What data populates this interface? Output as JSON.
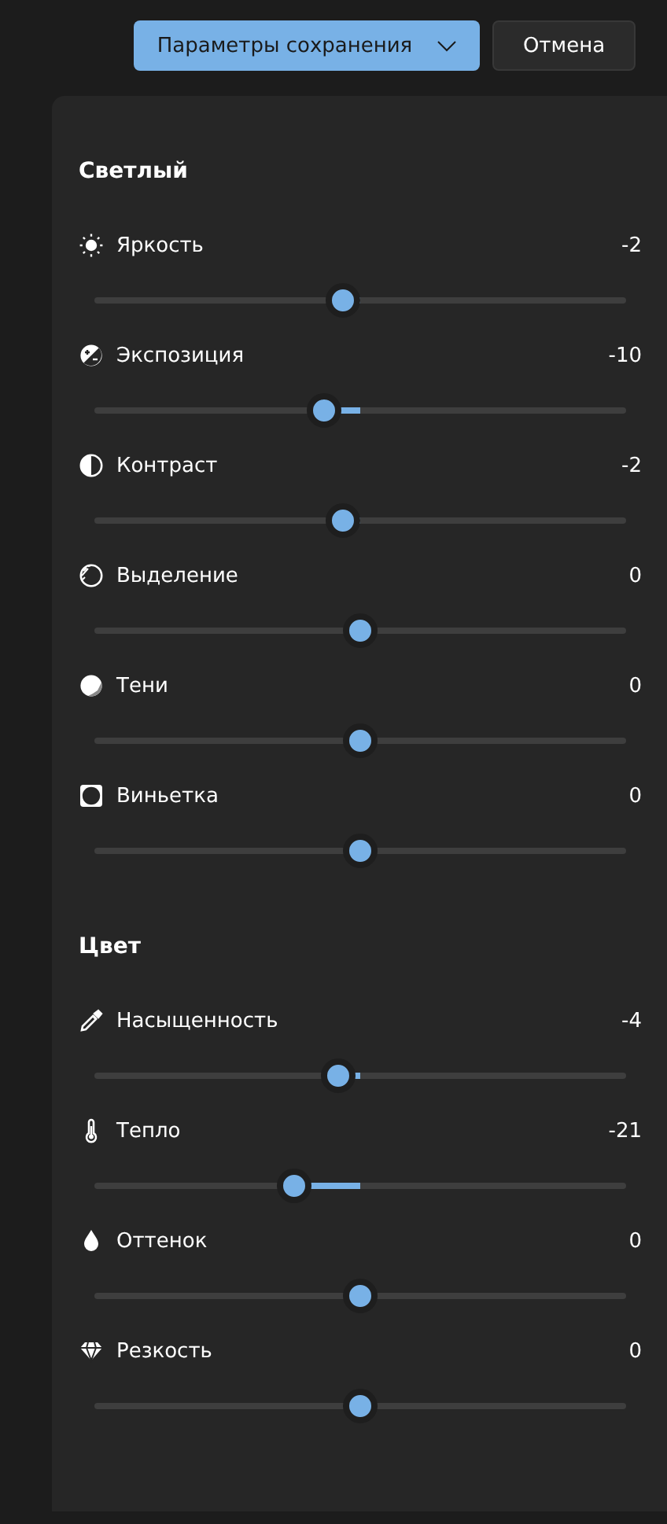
{
  "toolbar": {
    "save_options": {
      "label": "Параметры сохранения"
    },
    "cancel": {
      "label": "Отмена"
    }
  },
  "sections": [
    {
      "title": "Светлый",
      "adjustments": [
        {
          "label": "Яркость",
          "value": "-2",
          "level": 0.467
        },
        {
          "label": "Экспозиция",
          "value": "-10",
          "level": 0.432
        },
        {
          "label": "Контраст",
          "value": "-2",
          "level": 0.467
        },
        {
          "label": "Выделение",
          "value": "0",
          "level": 0.5
        },
        {
          "label": "Тени",
          "value": "0",
          "level": 0.5
        },
        {
          "label": "Виньетка",
          "value": "0",
          "level": 0.5
        }
      ]
    },
    {
      "title": "Цвет",
      "adjustments": [
        {
          "label": "Насыщенность",
          "value": "-4",
          "level": 0.46
        },
        {
          "label": "Тепло",
          "value": "-21",
          "level": 0.376
        },
        {
          "label": "Оттенок",
          "value": "0",
          "level": 0.5
        },
        {
          "label": "Резкость",
          "value": "0",
          "level": 0.5
        }
      ]
    }
  ]
}
